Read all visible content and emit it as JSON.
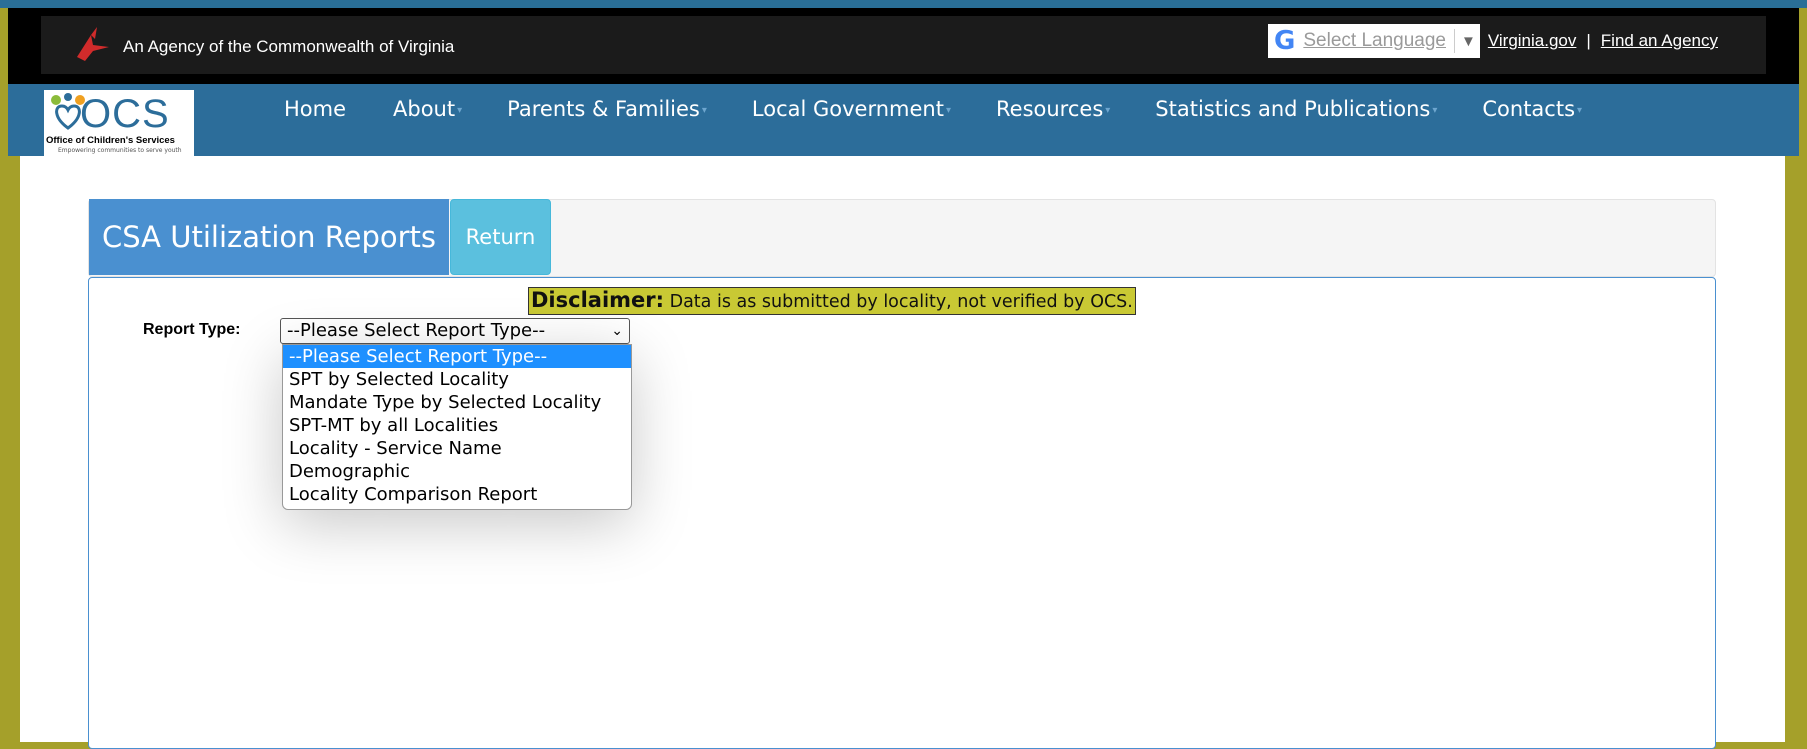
{
  "gov_bar": {
    "agency_text": "An Agency of the Commonwealth of Virginia",
    "language_label": "Select Language",
    "virginia_link": "Virginia.gov",
    "separator": "|",
    "find_agency_link": "Find an Agency"
  },
  "logo": {
    "word": "OCS",
    "subtitle": "Office of Children's Services",
    "tagline": "Empowering communities to serve youth"
  },
  "nav": {
    "items": [
      {
        "label": "Home",
        "has_caret": false
      },
      {
        "label": "About",
        "has_caret": true
      },
      {
        "label": "Parents & Families",
        "has_caret": true
      },
      {
        "label": "Local Government",
        "has_caret": true
      },
      {
        "label": "Resources",
        "has_caret": true
      },
      {
        "label": "Statistics and Publications",
        "has_caret": true
      },
      {
        "label": "Contacts",
        "has_caret": true
      }
    ]
  },
  "page": {
    "title": "CSA Utilization Reports",
    "return_label": "Return",
    "disclaimer_label": "Disclaimer:",
    "disclaimer_text": "Data is as submitted by locality, not verified by OCS.",
    "report_type_label": "Report Type:",
    "report_type_value": "--Please Select Report Type--",
    "report_type_options": [
      "--Please Select Report Type--",
      "SPT by Selected Locality",
      "Mandate Type by Selected Locality",
      "SPT-MT by all Localities",
      "Locality - Service Name",
      "Demographic",
      "Locality Comparison Report"
    ],
    "selected_option_index": 0
  },
  "colors": {
    "frame": "#a5a02a",
    "nav_blue": "#2c6d9a",
    "tab_blue": "#4a90d0",
    "return_cyan": "#5bc0de",
    "disclaimer_yellow": "#c9c934",
    "option_highlight": "#1e90ff"
  }
}
